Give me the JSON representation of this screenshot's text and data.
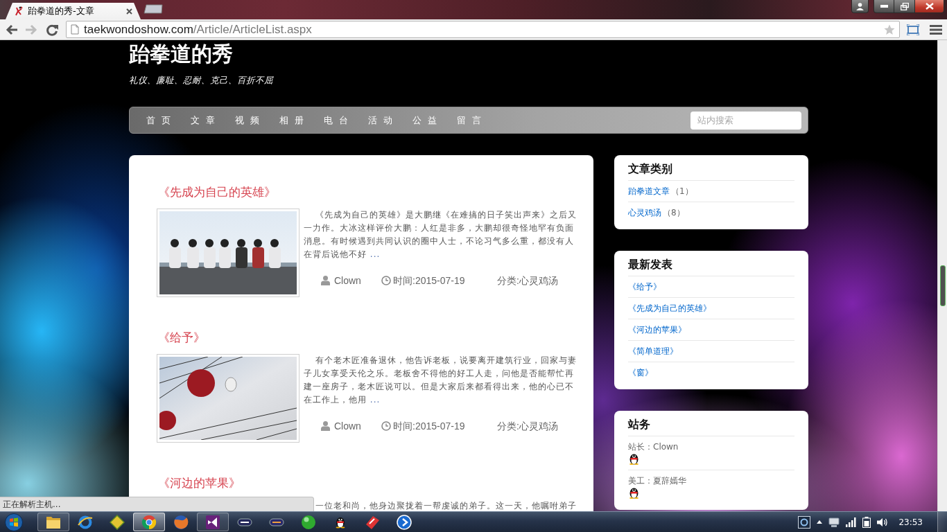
{
  "browser": {
    "tabs": [
      {
        "title": "跆拳道的秀-文章",
        "selected": true
      }
    ],
    "nav_buttons": [
      {
        "kind": "back",
        "disabled": false
      },
      {
        "kind": "forward",
        "disabled": true
      },
      {
        "kind": "reload",
        "disabled": false
      }
    ],
    "url": {
      "host": "taekwondoshow.com",
      "path": "/Article/ArticleList.aspx"
    }
  },
  "site": {
    "title": "跆拳道的秀",
    "motto": "礼仪、廉耻、忍耐、克己、百折不屈"
  },
  "nav": {
    "items": [
      "首页",
      "文章",
      "视频",
      "相册",
      "电台",
      "活动",
      "公益",
      "留言"
    ],
    "search": {
      "placeholder": "站内搜索"
    }
  },
  "articles": [
    {
      "kind": "people",
      "title": "《先成为自己的英雄》",
      "excerpt": "《先成为自己的英雄》是大鹏继《在难搞的日子笑出声来》之后又一力作。大冰这样评价大鹏：人红是非多，大鹏却很奇怪地罕有负面消息。有时候遇到共同认识的圈中人士，不论习气多么重，都没有人在背后说他不好",
      "more": "...",
      "author": "Clown",
      "time": "时间:2015-07-19",
      "category": "分类:心灵鸡汤"
    },
    {
      "kind": "lanterns",
      "title": "《给予》",
      "excerpt": "有个老木匠准备退休，他告诉老板，说要离开建筑行业，回家与妻子儿女享受天伦之乐。老板舍不得他的好工人走，问他是否能帮忙再建一座房子，老木匠说可以。但是大家后来都看得出来，他的心已不在工作上，他用",
      "more": "...",
      "author": "Clown",
      "time": "时间:2015-07-19",
      "category": "分类:心灵鸡汤"
    },
    {
      "kind": "covered",
      "title": "《河边的苹果》",
      "excerpt": "一位老和尚，他身边聚拢着一帮虔诚的弟子。这一天，他嘱咐弟子"
    }
  ],
  "sidebar": {
    "categories": {
      "title": "文章类别",
      "items": [
        {
          "name": "跆拳道文章",
          "count": "（1）"
        },
        {
          "name": "心灵鸡汤",
          "count": "（8）"
        }
      ]
    },
    "recent": {
      "title": "最新发表",
      "items": [
        "《给予》",
        "《先成为自己的英雄》",
        "《河边的苹果》",
        "《简单道理》",
        "《窗》"
      ]
    },
    "staff": {
      "title": "站务",
      "members": [
        "站长：Clown",
        "美工：夏辞嫣华"
      ]
    }
  },
  "status_bubble": "正在解析主机...",
  "taskbar": {
    "apps": [
      {
        "kind": "folder",
        "running": true,
        "selected": false
      },
      {
        "kind": "ring",
        "running": false,
        "selected": false
      },
      {
        "kind": "diamond",
        "running": false,
        "selected": false
      },
      {
        "kind": "segmented",
        "running": true,
        "selected": true
      },
      {
        "kind": "globe",
        "running": false,
        "selected": false
      },
      {
        "kind": "ribbon",
        "running": true,
        "selected": false
      },
      {
        "kind": "capsule",
        "running": false,
        "selected": false
      },
      {
        "kind": "capsule-alt",
        "running": false,
        "selected": false
      },
      {
        "kind": "ball",
        "running": false,
        "selected": false
      },
      {
        "kind": "penguin",
        "running": false,
        "selected": false
      },
      {
        "kind": "tag",
        "running": false,
        "selected": false
      },
      {
        "kind": "disc",
        "running": false,
        "selected": false
      }
    ],
    "clock": "23:53"
  }
}
